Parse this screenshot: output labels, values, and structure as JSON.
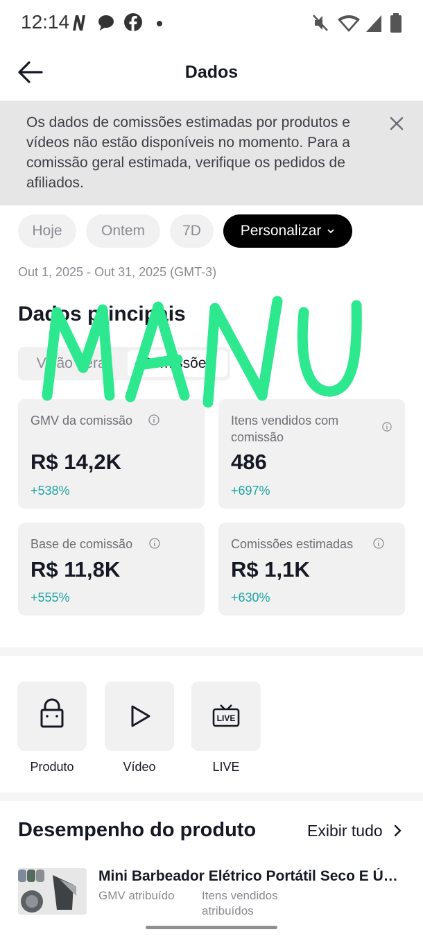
{
  "status_bar": {
    "time": "12:14",
    "icons": [
      "notification-n-icon",
      "chat-bubble-icon",
      "facebook-icon",
      "dot-icon",
      "mute-icon",
      "wifi-icon",
      "signal-icon",
      "battery-icon"
    ]
  },
  "header": {
    "title": "Dados"
  },
  "banner": {
    "text": "Os dados de comissões estimadas por produtos e vídeos não estão disponíveis no momento. Para a comissão geral estimada, verifique os pedidos de afiliados."
  },
  "filters": {
    "chips": [
      "Hoje",
      "Ontem",
      "7D",
      "Personalizar"
    ],
    "active": "Personalizar",
    "date_range": "Out 1, 2025 - Out 31, 2025 (GMT-3)"
  },
  "main_data": {
    "title": "Dados principais",
    "segments": [
      "Visão geral",
      "Comissões"
    ],
    "active_segment": "Comissões",
    "metrics": [
      {
        "label": "GMV da comissão",
        "value": "R$ 14,2K",
        "delta": "+538%"
      },
      {
        "label": "Itens vendidos com comissão",
        "value": "486",
        "delta": "+697%"
      },
      {
        "label": "Base de comissão",
        "value": "R$ 11,8K",
        "delta": "+555%"
      },
      {
        "label": "Comissões estimadas",
        "value": "R$ 1,1K",
        "delta": "+630%"
      }
    ]
  },
  "shortcuts": [
    {
      "label": "Produto",
      "icon": "shopping-bag-icon"
    },
    {
      "label": "Vídeo",
      "icon": "play-icon"
    },
    {
      "label": "LIVE",
      "icon": "live-tv-icon"
    }
  ],
  "product_performance": {
    "title": "Desempenho do produto",
    "see_all": "Exibir tudo",
    "items": [
      {
        "name": "Mini Barbeador Elétrico Portátil Seco E Úmido",
        "meta_1": "GMV atribuído",
        "meta_2": "Itens vendidos atribuídos"
      }
    ]
  },
  "overlay": {
    "watermark_text": "MANU",
    "watermark_color": "#2ee88f"
  },
  "colors": {
    "accent_teal": "#1fa3a3",
    "chip_active": "#000000"
  }
}
